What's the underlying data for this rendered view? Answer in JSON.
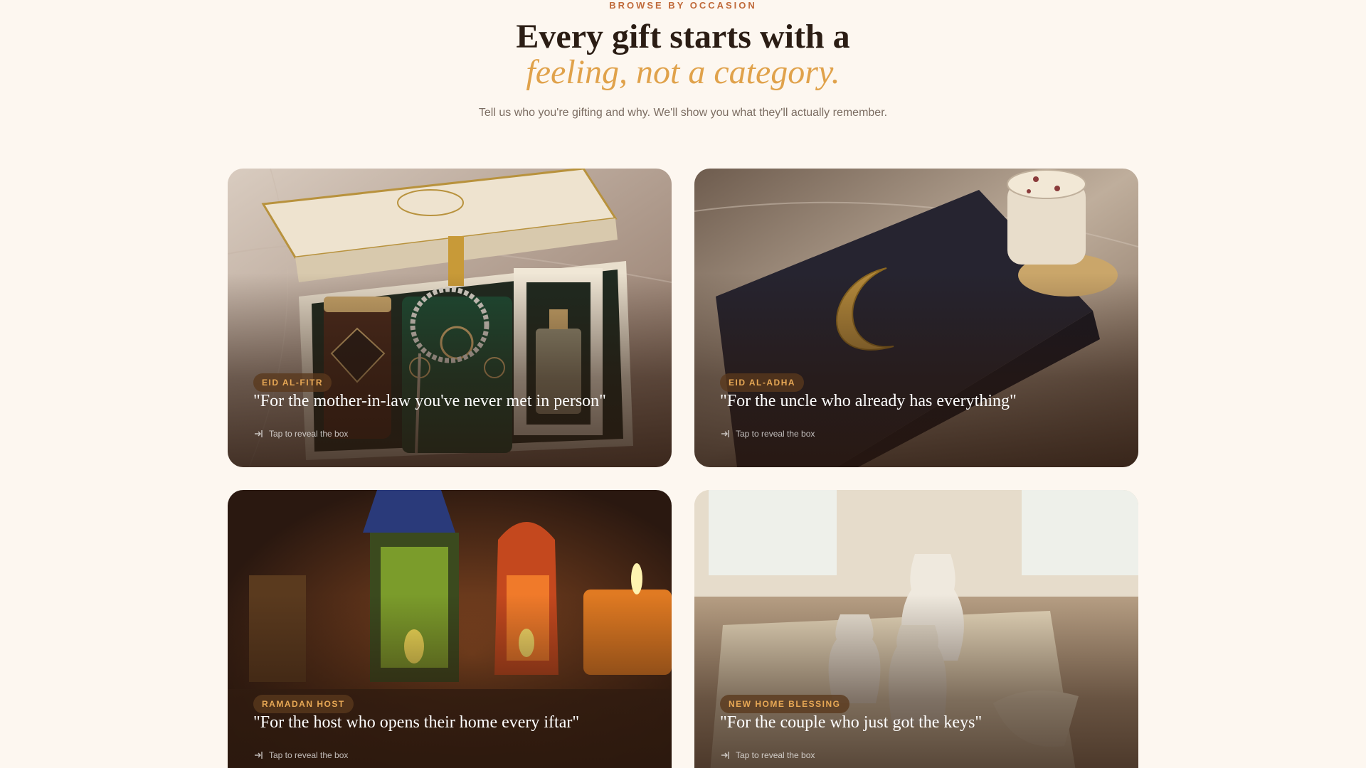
{
  "header": {
    "eyebrow": "BROWSE BY OCCASION",
    "title_line1": "Every gift starts with a",
    "title_line2": "feeling, not a category.",
    "subtitle": "Tell us who you're gifting and why. We'll show you what they'll actually remember."
  },
  "cards": [
    {
      "tag": "EID AL-FITR",
      "quote": "\"For the mother-in-law you've never met in person\"",
      "cta": "Tap to reveal the box",
      "image": "gift box with Desert Harvest jar, green prayer mat, rosary beads and perfume bottle"
    },
    {
      "tag": "EID AL-ADHA",
      "quote": "\"For the uncle who already has everything\"",
      "cta": "Tap to reveal the box",
      "image": "dark navy box with gold crescent moon and candle"
    },
    {
      "tag": "RAMADAN HOST",
      "quote": "\"For the host who opens their home every iftar\"",
      "cta": "Tap to reveal the box",
      "image": "glowing lanterns and candle"
    },
    {
      "tag": "NEW HOME BLESSING",
      "quote": "\"For the couple who just got the keys\"",
      "cta": "Tap to reveal the box",
      "image": "ceramic vases on a table runner"
    }
  ],
  "colors": {
    "background": "#fdf7f0",
    "accent": "#e0a24b",
    "eyebrow": "#c06a3a",
    "heading": "#2b1d14"
  },
  "icons": {
    "cta": "enter-arrow-icon"
  }
}
